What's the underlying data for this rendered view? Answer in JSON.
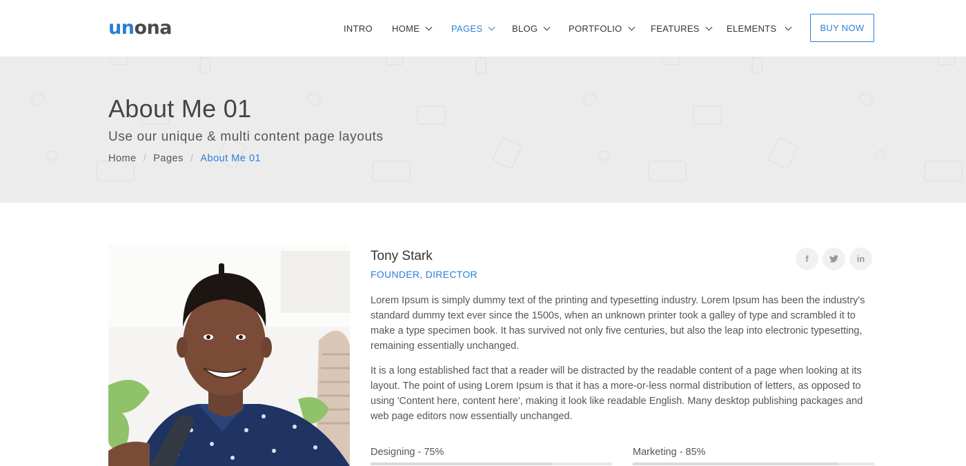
{
  "brand": {
    "logo_part1": "un",
    "logo_part2": "ona",
    "accent_color": "#2a7fd4"
  },
  "nav": {
    "items": [
      {
        "label": "INTRO"
      },
      {
        "label": "HOME"
      },
      {
        "label": "PAGES"
      },
      {
        "label": "BLOG"
      },
      {
        "label": "PORTFOLIO"
      },
      {
        "label": "FEATURES"
      },
      {
        "label": "ELEMENTS"
      }
    ],
    "active": "PAGES",
    "cta_label": "BUY NOW"
  },
  "page_header": {
    "title": "About Me 01",
    "subtitle": "Use our unique & multi content page layouts",
    "breadcrumb": [
      "Home",
      "Pages",
      "About Me 01"
    ],
    "breadcrumb_separator": "/"
  },
  "profile": {
    "name": "Tony Stark",
    "role": "FOUNDER, DIRECTOR",
    "social": [
      {
        "icon": "facebook-icon",
        "glyph": "f"
      },
      {
        "icon": "twitter-icon",
        "glyph": "t"
      },
      {
        "icon": "linkedin-icon",
        "glyph": "in"
      }
    ],
    "paragraphs": [
      "Lorem Ipsum is simply dummy text of the printing and typesetting industry. Lorem Ipsum has been the industry's standard dummy text ever since the 1500s, when an unknown printer took a galley of type and scrambled it to make a type specimen book. It has survived not only five centuries, but also the leap into electronic typesetting, remaining essentially unchanged.",
      "It is a long established fact that a reader will be distracted by the readable content of a page when looking at its layout. The point of using Lorem Ipsum is that it has a more-or-less normal distribution of letters, as opposed to using 'Content here, content here', making it look like readable English. Many desktop publishing packages and web page editors now essentially unchanged."
    ],
    "skills": [
      {
        "label": "Designing - 75%",
        "percent": 75
      },
      {
        "label": "Marketing - 85%",
        "percent": 85
      }
    ]
  }
}
